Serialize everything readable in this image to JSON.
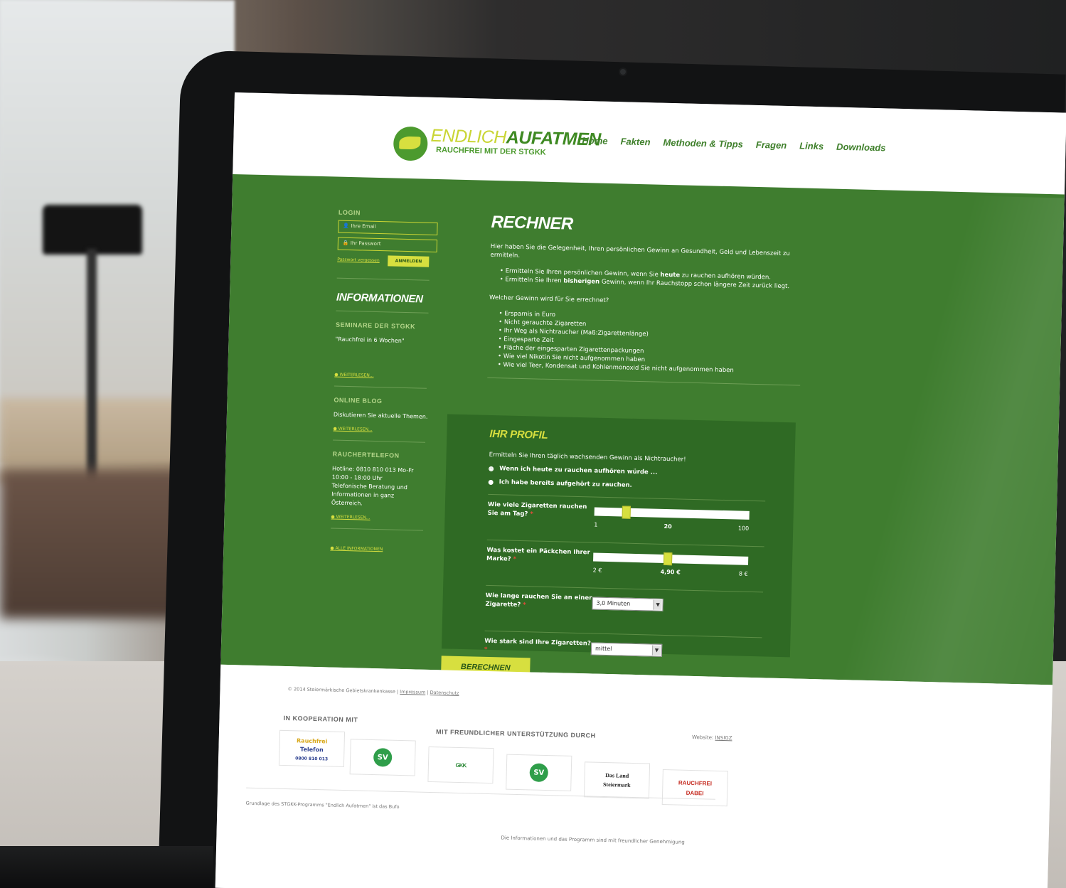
{
  "logo": {
    "word_a": "ENDLICH",
    "word_b": "AUFATMEN",
    "tagline": "RAUCHFREI MIT DER STGKK"
  },
  "nav": {
    "items": [
      {
        "label": "Home"
      },
      {
        "label": "Fakten"
      },
      {
        "label": "Methoden & Tipps"
      },
      {
        "label": "Fragen"
      },
      {
        "label": "Links"
      },
      {
        "label": "Downloads"
      }
    ]
  },
  "sidebar": {
    "login_heading": "LOGIN",
    "email_placeholder": "Ihre Email",
    "password_placeholder": "Ihr Passwort",
    "forgot_password": "Passwort vergessen",
    "login_button": "ANMELDEN",
    "info_title": "INFORMATIONEN",
    "seminar_heading": "SEMINARE DER STGKK",
    "seminar_text": "\"Rauchfrei in 6 Wochen\"",
    "more_1": "WEITERLESEN...",
    "blog_heading": "ONLINE BLOG",
    "blog_text": "Diskutieren Sie aktuelle Themen.",
    "more_2": "WEITERLESEN...",
    "phone_heading": "RAUCHERTELEFON",
    "phone_text": "Hotline: 0810 810 013 Mo-Fr 10:00 - 18:00 Uhr Telefonische Beratung und Informationen in ganz Österreich.",
    "more_3": "WEITERLESEN...",
    "all_info": "ALLE INFORMATIONEN"
  },
  "content": {
    "title": "RECHNER",
    "intro": "Hier haben Sie die Gelegenheit, Ihren persönlichen Gewinn an Gesundheit, Geld und Lebenszeit zu ermitteln.",
    "bullet1_pre": "Ermitteln Sie Ihren persönlichen Gewinn, wenn Sie ",
    "bullet1_bold": "heute",
    "bullet1_post": " zu rauchen aufhören würden.",
    "bullet2_pre": "Ermitteln Sie Ihren ",
    "bullet2_bold": "bisherigen",
    "bullet2_post": " Gewinn, wenn Ihr Rauchstopp schon längere Zeit zurück liegt.",
    "question": "Welcher Gewinn wird für Sie errechnet?",
    "gains": [
      "Ersparnis in Euro",
      "Nicht gerauchte Zigaretten",
      "Ihr Weg als Nichtraucher (Maß:Zigarettenlänge)",
      "Eingesparte Zeit",
      "Fläche der eingesparten Zigarettenpackungen",
      "Wie viel Nikotin Sie nicht aufgenommen haben",
      "Wie viel Teer, Kondensat und Kohlenmonoxid Sie nicht aufgenommen haben"
    ]
  },
  "profile": {
    "title": "IHR PROFIL",
    "lead": "Ermitteln Sie Ihren täglich wachsenden Gewinn als Nichtraucher!",
    "radio1": "Wenn ich heute zu rauchen aufhören würde ...",
    "radio2": "Ich habe bereits aufgehört zu rauchen.",
    "q1": "Wie viele Zigaretten rauchen Sie am Tag?",
    "s1_min": "1",
    "s1_value_label": "20",
    "s1_max": "100",
    "s1_level": 0.19,
    "q2": "Was kostet ein Päckchen Ihrer Marke?",
    "s2_min": "2 €",
    "s2_value_label": "4,90 €",
    "s2_max": "8 €",
    "s2_level": 0.48,
    "q3": "Wie lange rauchen Sie an einer Zigarette?",
    "sel3": "3,0 Minuten",
    "q4": "Wie stark sind Ihre Zigaretten?",
    "sel4": "mittel",
    "required_mark": "*",
    "submit": "BERECHNEN"
  },
  "footer": {
    "copyright": "© 2014 Steiermärkische Gebietskrankenkasse | ",
    "impressum": "Impressum",
    "sep": " | ",
    "datenschutz": "Datenschutz",
    "koop_heading": "IN KOOPERATION MIT",
    "support_heading": "MIT FREUNDLICHER UNTERSTÜTZUNG DURCH",
    "website_label": "Website: ",
    "website_link": "INSIGZ",
    "rauchfrei_partner_1": "Rauchfrei",
    "rauchfrei_partner_2": "Telefon",
    "rauchfrei_partner_3": "0800 810 013",
    "sv_label": "SV",
    "gkk_label": "GKK",
    "land_line1": "Das Land",
    "land_line2": "Steiermark",
    "dabei_line1": "RAUCHFREI",
    "dabei_line2": "DABEI",
    "grundlage": "Grundlage des STGKK-Programms \"Endlich Aufatmen\" ist das Bufo",
    "hinweis": "Die Informationen und das Programm sind mit freundlicher Genehmigung"
  },
  "colors": {
    "site_green": "#3f7d2f",
    "profile_green": "#2f6a24",
    "accent_yellow": "#d7df3f"
  }
}
